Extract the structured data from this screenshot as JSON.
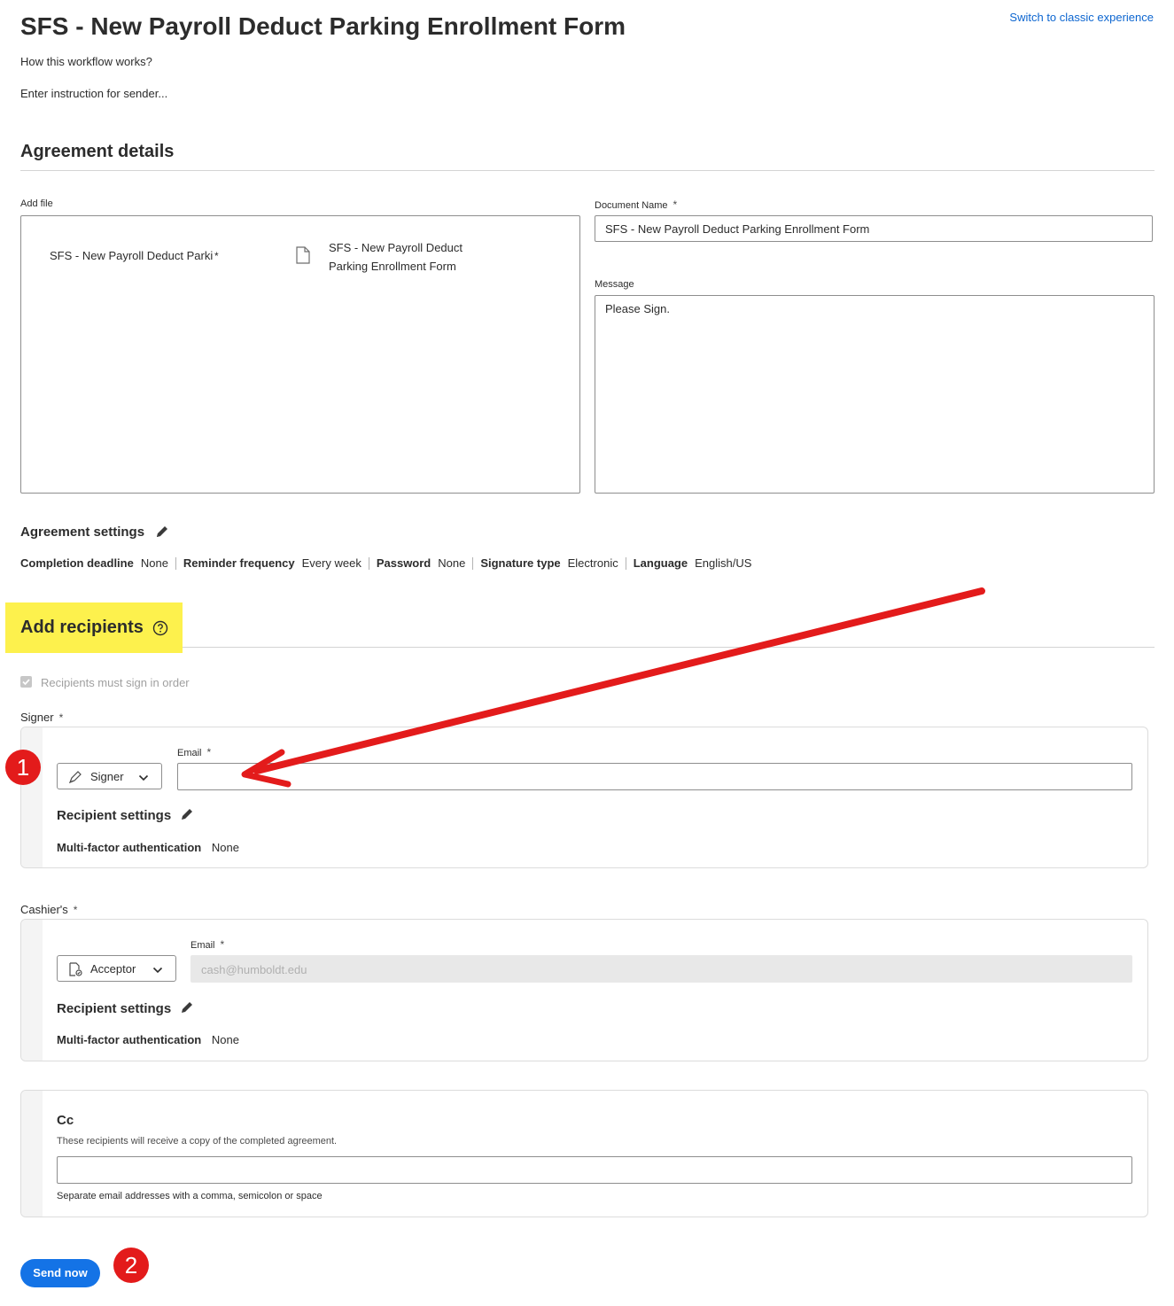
{
  "header": {
    "title": "SFS - New Payroll Deduct Parking Enrollment Form",
    "switch_link": "Switch to classic experience",
    "how_link": "How this workflow works?",
    "instruction": "Enter instruction for sender..."
  },
  "agreement": {
    "section_title": "Agreement details",
    "add_file_label": "Add file",
    "file_slot_name": "SFS - New Payroll Deduct Parking",
    "file_name": "SFS - New Payroll Deduct Parking Enrollment Form",
    "document_name_label": "Document Name",
    "document_name_value": "SFS - New Payroll Deduct Parking Enrollment Form",
    "message_label": "Message",
    "message_value": "Please Sign.",
    "required_mark": "*"
  },
  "settings": {
    "title": "Agreement settings",
    "items": [
      {
        "key": "Completion deadline",
        "value": "None"
      },
      {
        "key": "Reminder frequency",
        "value": "Every week"
      },
      {
        "key": "Password",
        "value": "None"
      },
      {
        "key": "Signature type",
        "value": "Electronic"
      },
      {
        "key": "Language",
        "value": "English/US"
      }
    ]
  },
  "recipients": {
    "section_title": "Add recipients",
    "order_label": "Recipients must sign in order",
    "signer": {
      "role_label": "Signer",
      "dropdown": "Signer",
      "email_label": "Email",
      "email_value": "",
      "settings_title": "Recipient settings",
      "mfa_key": "Multi-factor authentication",
      "mfa_value": "None"
    },
    "cashier": {
      "role_label": "Cashier's",
      "dropdown": "Acceptor",
      "email_label": "Email",
      "email_value": "cash@humboldt.edu",
      "settings_title": "Recipient settings",
      "mfa_key": "Multi-factor authentication",
      "mfa_value": "None"
    },
    "cc": {
      "title": "Cc",
      "description": "These recipients will receive a copy of the completed agreement.",
      "hint": "Separate email addresses with a comma, semicolon or space",
      "value": ""
    }
  },
  "actions": {
    "send_label": "Send now"
  },
  "annotations": {
    "badge_1": "1",
    "badge_2": "2",
    "highlight_color": "#fdf14d",
    "arrow_color": "#e31b1b"
  },
  "colors": {
    "accent": "#1473e6",
    "link": "#0d66d0"
  }
}
